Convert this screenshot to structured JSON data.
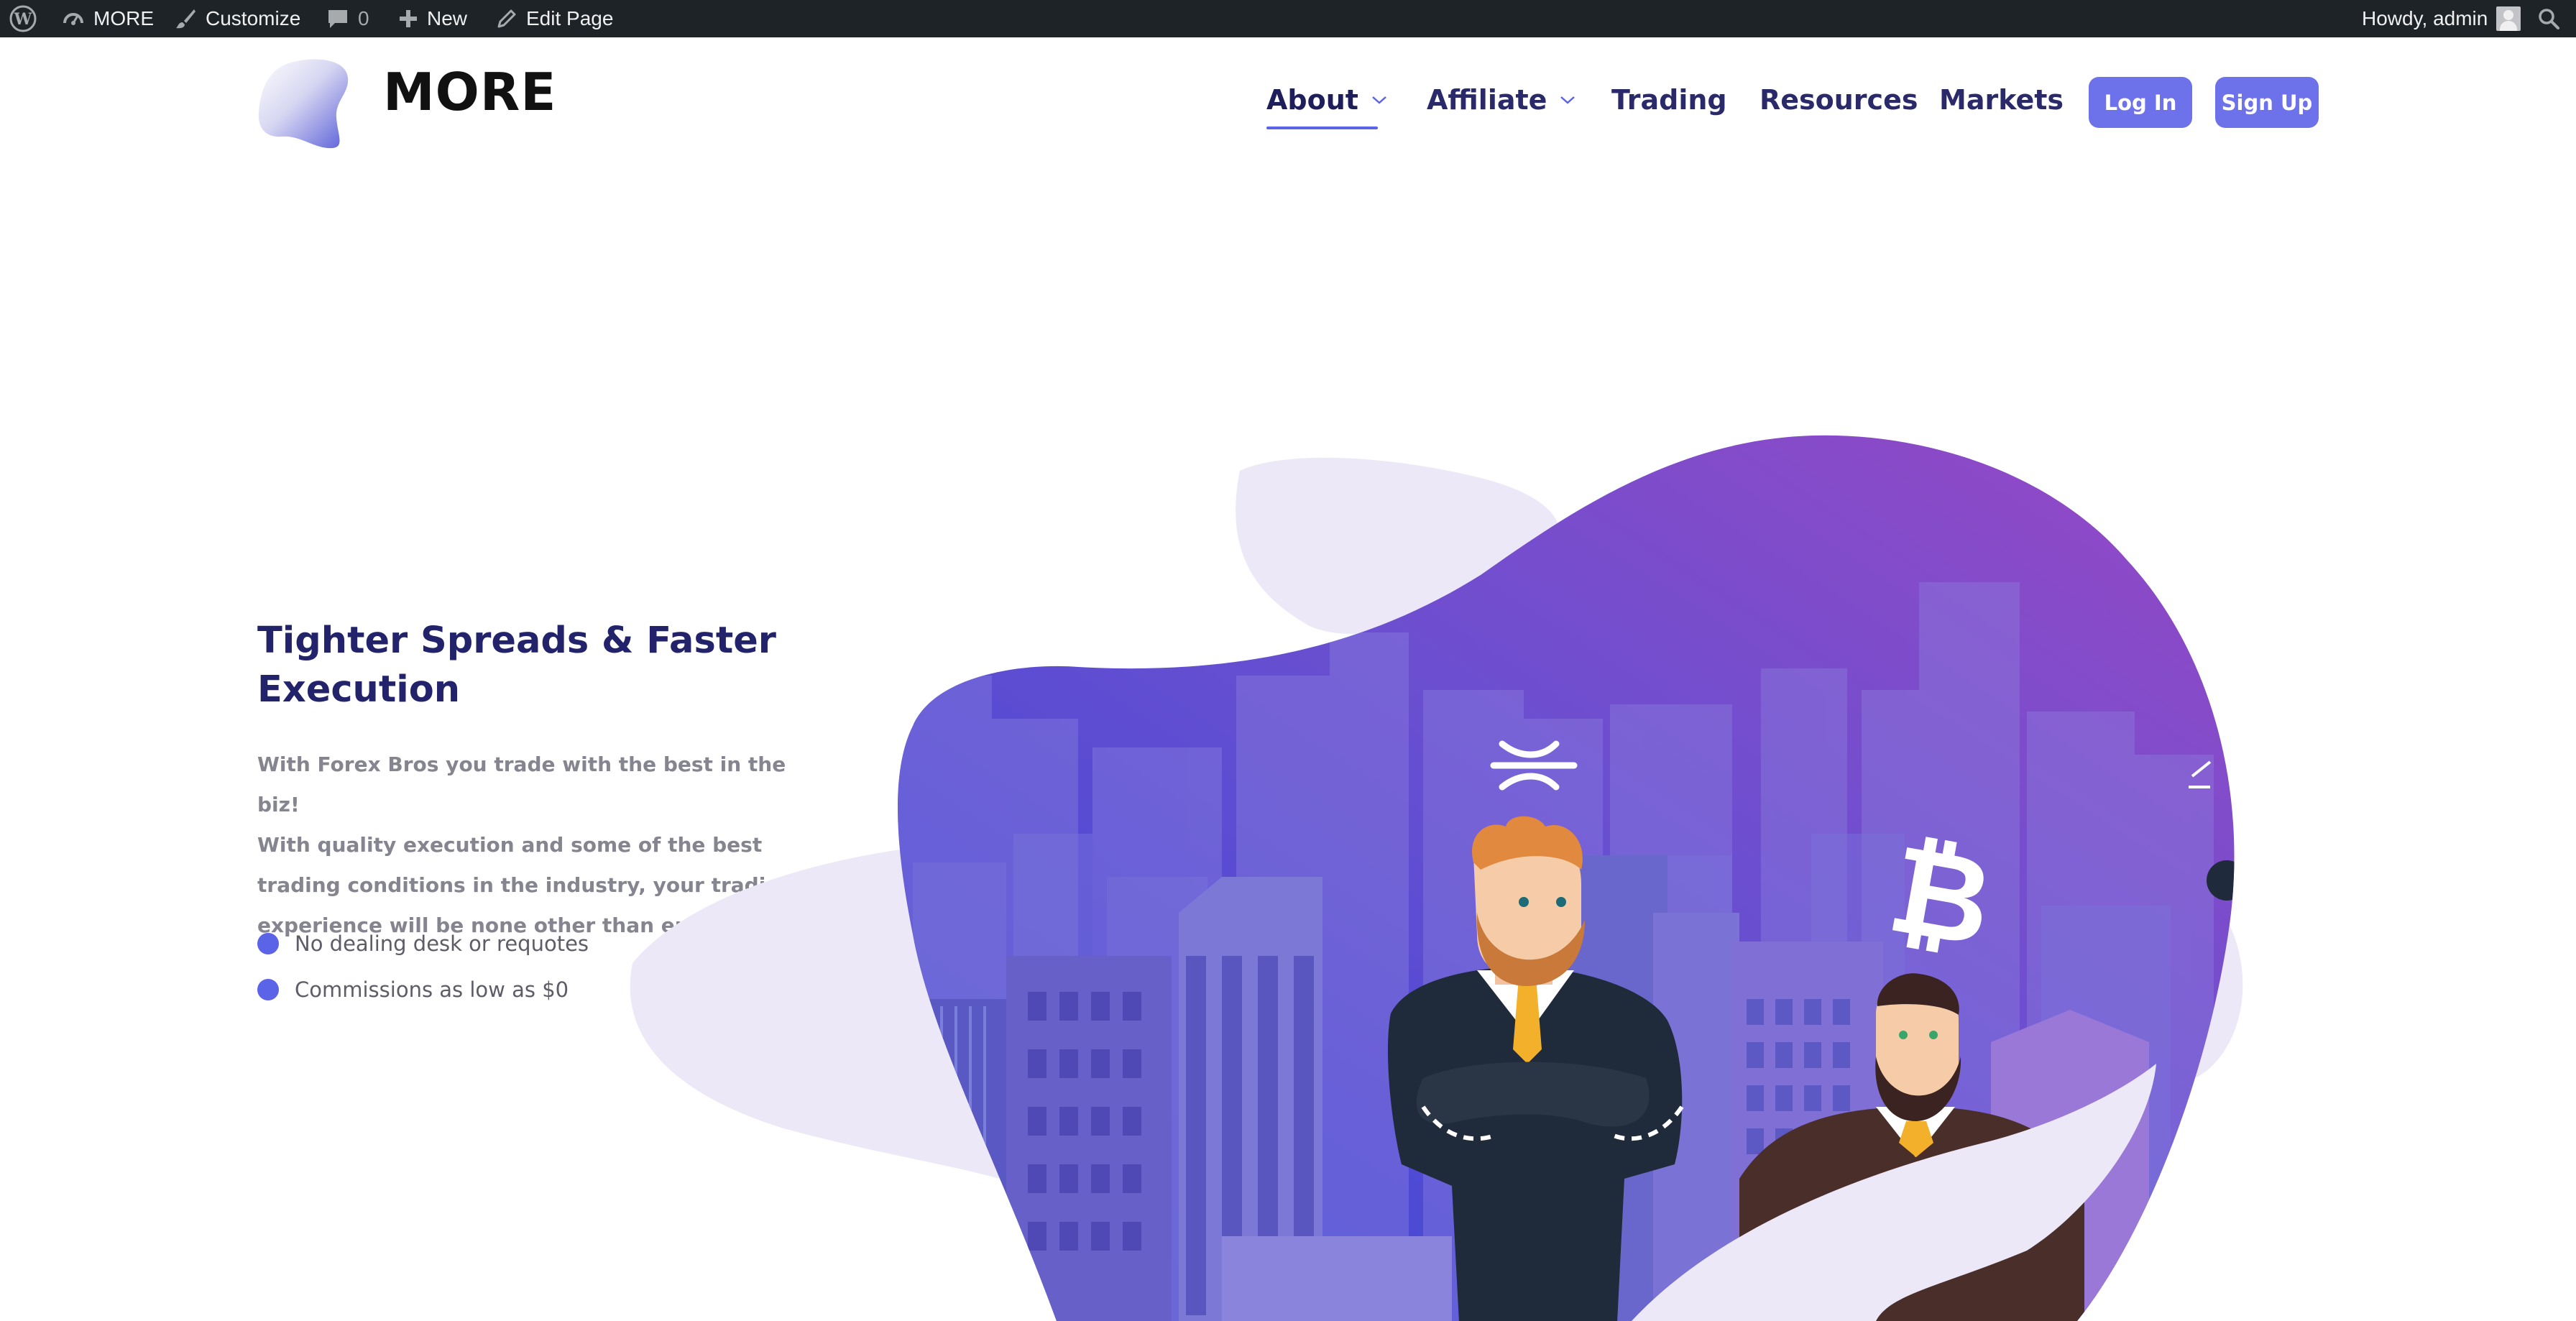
{
  "admin_bar": {
    "site_name": "MORE",
    "customize": "Customize",
    "comments_count": "0",
    "new": "New",
    "edit_page": "Edit Page",
    "howdy": "Howdy, admin",
    "icons": [
      "wordpress-icon",
      "dashboard-icon",
      "paintbrush-icon",
      "comment-icon",
      "plus-icon",
      "pencil-icon",
      "avatar",
      "search-icon"
    ]
  },
  "header": {
    "brand": "MORE",
    "nav": [
      {
        "label": "About",
        "dropdown": true,
        "active": true
      },
      {
        "label": "Affiliate",
        "dropdown": true
      },
      {
        "label": "Trading"
      },
      {
        "label": "Resources"
      },
      {
        "label": "Markets"
      }
    ],
    "login": "Log In",
    "signup": "Sign Up"
  },
  "hero": {
    "title_line1": "Tighter Spreads & Faster",
    "title_line2": "Execution",
    "desc_lines": [
      "With Forex Bros you trade with the best in the biz!",
      "With quality execution and some of the best",
      "trading conditions in the industry, your trading",
      "experience will be none other than epic."
    ],
    "features": [
      "No dealing desk or requotes",
      "Commissions as low as $0"
    ]
  },
  "colors": {
    "admin_bar_bg": "#1d2327",
    "accent": "#5b63e6",
    "button": "#6d71ea",
    "heading": "#23236b",
    "blob_light": "#ece8f7",
    "gradient_start": "#3e4fd6",
    "gradient_end": "#8e4cc8"
  }
}
